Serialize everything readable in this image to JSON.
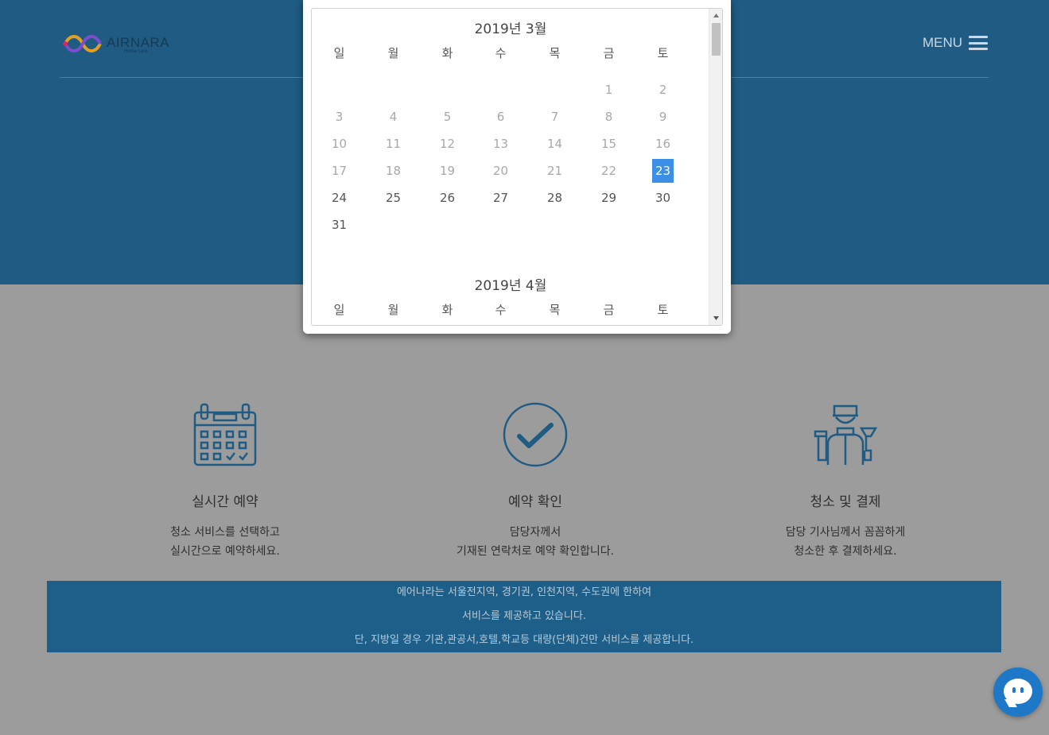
{
  "header": {
    "logo_text": "AIRNARA",
    "logo_sub": "Home care",
    "menu_label": "MENU"
  },
  "calendar": {
    "months": [
      {
        "title": "2019년 3월",
        "weekdays": [
          "일",
          "월",
          "화",
          "수",
          "목",
          "금",
          "토"
        ],
        "first_weekday": 5,
        "days": 31,
        "selected_day": 23
      },
      {
        "title": "2019년 4월",
        "weekdays": [
          "일",
          "월",
          "화",
          "수",
          "목",
          "금",
          "토"
        ]
      }
    ]
  },
  "features": [
    {
      "icon": "calendar-icon",
      "title": "실시간 예약",
      "line1": "청소 서비스를 선택하고",
      "line2": "실시간으로 예약하세요."
    },
    {
      "icon": "check-circle-icon",
      "title": "예약 확인",
      "line1": "담당자께서",
      "line2": "기재된 연락처로 예약 확인합니다."
    },
    {
      "icon": "cleaner-icon",
      "title": "청소 및 결제",
      "line1": "담당 기사님께서 꼼꼼하게",
      "line2": "청소한 후 결제하세요."
    }
  ],
  "notice": {
    "line1": "에어나라는 서울전지역, 경기권, 인천지역, 수도권에 한하여",
    "line2": "서비스를 제공하고 있습니다.",
    "line3": "단, 지방일 경우 기관,관공서,호텔,학교등 대량(단체)건만 서비스를 제공합니다."
  },
  "colors": {
    "accent": "#3d8ee5",
    "header_bg": "#1f5b82",
    "notice_bg": "#1e5f8a",
    "chat_bg": "#1e78c8"
  }
}
